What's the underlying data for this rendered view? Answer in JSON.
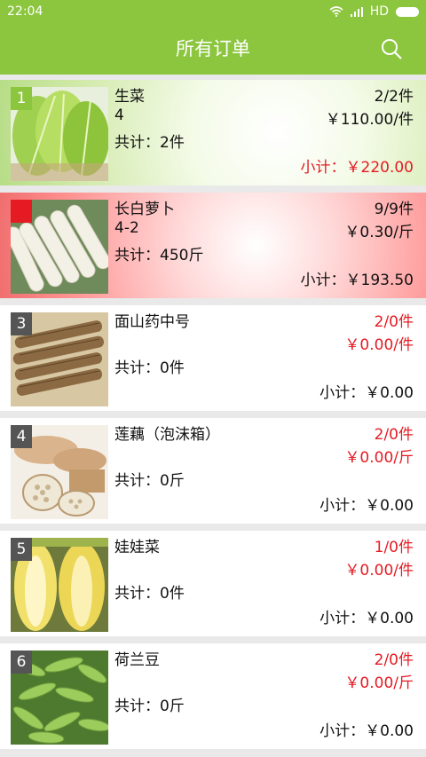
{
  "status": {
    "time": "22:04",
    "network": "HD"
  },
  "header": {
    "title": "所有订单"
  },
  "colors": {
    "accent": "#8cc63f",
    "highlight_red": "#e51b23"
  },
  "orders": [
    {
      "index": "1",
      "name": "生菜",
      "spec": "4",
      "qty": "2/2件",
      "price": "￥110.00/件",
      "total": "共计：2件",
      "subtotal": "小计：￥220.00"
    },
    {
      "index": "2",
      "name": "长白萝卜",
      "spec": "4-2",
      "qty": "9/9件",
      "price": "￥0.30/斤",
      "total": "共计：450斤",
      "subtotal": "小计：￥193.50"
    },
    {
      "index": "3",
      "name": "面山药中号",
      "spec": "",
      "qty": "2/0件",
      "price": "￥0.00/件",
      "total": "共计：0件",
      "subtotal": "小计：￥0.00"
    },
    {
      "index": "4",
      "name": "莲藕（泡沫箱）",
      "spec": "",
      "qty": "2/0件",
      "price": "￥0.00/斤",
      "total": "共计：0斤",
      "subtotal": "小计：￥0.00"
    },
    {
      "index": "5",
      "name": "娃娃菜",
      "spec": "",
      "qty": "1/0件",
      "price": "￥0.00/件",
      "total": "共计：0件",
      "subtotal": "小计：￥0.00"
    },
    {
      "index": "6",
      "name": "荷兰豆",
      "spec": "",
      "qty": "2/0件",
      "price": "￥0.00/斤",
      "total": "共计：0斤",
      "subtotal": "小计：￥0.00"
    }
  ]
}
